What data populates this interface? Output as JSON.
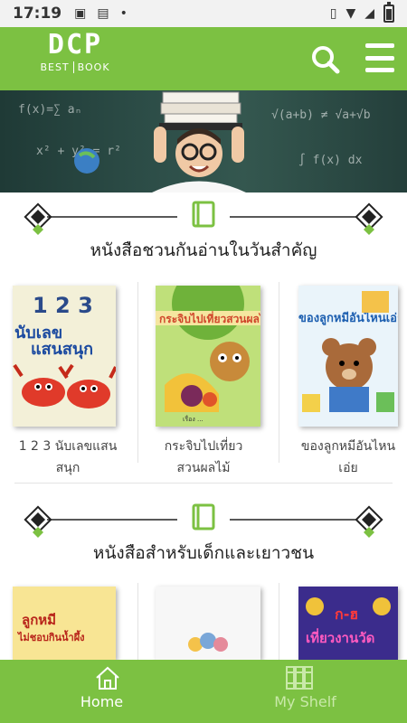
{
  "status_bar": {
    "time": "17:19"
  },
  "app_bar": {
    "logo_mark": "DCP",
    "logo_left": "BEST",
    "logo_right": "BOOK",
    "search_icon": "search-icon",
    "menu_icon": "hamburger-menu-icon"
  },
  "colors": {
    "brand_green": "#7cc142",
    "inactive_nav": "#c9e9a9"
  },
  "sections": [
    {
      "title": "หนังสือชวนกันอ่านในวันสำคัญ",
      "books": [
        {
          "title_line1": "1 2 3 นับเลขแสน",
          "title_line2": "สนุก",
          "cover_text": "นับเลขแสนสนุก"
        },
        {
          "title_line1": "กระจิบไปเที่ยว",
          "title_line2": "สวนผลไม้",
          "cover_text": "กระจิบไปเที่ยวสวนผลไม้"
        },
        {
          "title_line1": "ของลูกหมีอันไหน",
          "title_line2": "เอ่ย",
          "cover_text": "ของลูกหมีอันไหนเอ่ย"
        }
      ]
    },
    {
      "title": "หนังสือสำหรับเด็กและเยาวชน",
      "books": [
        {
          "cover_text": "ลูกหมีไม่ชอบกินน้ำผึ้ง"
        },
        {
          "cover_text": ""
        },
        {
          "cover_text": "ก-ฮ เที่ยวงานวัด"
        }
      ]
    }
  ],
  "bottom_nav": {
    "home_label": "Home",
    "shelf_label": "My Shelf"
  }
}
